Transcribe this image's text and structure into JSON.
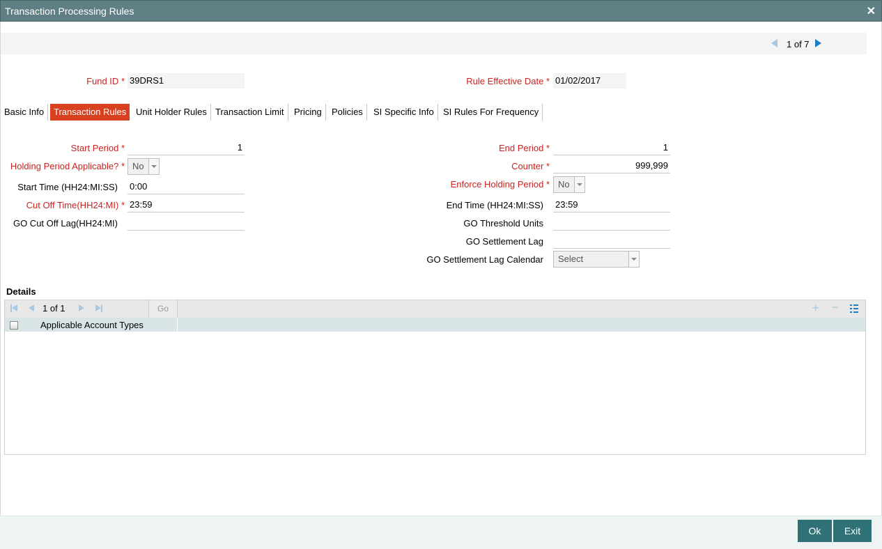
{
  "window": {
    "title": "Transaction Processing Rules",
    "close_glyph": "✕"
  },
  "pager": {
    "text": "1 of 7"
  },
  "header": {
    "fund_id_label": "Fund ID",
    "fund_id_value": "39DRS1",
    "rule_effective_date_label": "Rule Effective Date",
    "rule_effective_date_value": "01/02/2017",
    "required_mark": "*"
  },
  "tabs": [
    {
      "label": "Basic Info",
      "active": false
    },
    {
      "label": "Transaction Rules",
      "active": true
    },
    {
      "label": "Unit Holder Rules",
      "active": false
    },
    {
      "label": "Transaction Limit",
      "active": false
    },
    {
      "label": "Pricing",
      "active": false
    },
    {
      "label": "Policies",
      "active": false
    },
    {
      "label": "SI Specific Info",
      "active": false
    },
    {
      "label": "SI Rules For Frequency",
      "active": false
    }
  ],
  "form": {
    "start_period": {
      "label": "Start Period",
      "value": "1"
    },
    "holding_period_applicable": {
      "label": "Holding Period Applicable?",
      "value": "No"
    },
    "start_time": {
      "label": "Start Time (HH24:MI:SS)",
      "value": "0:00"
    },
    "cut_off_time": {
      "label": "Cut Off Time(HH24:MI)",
      "value": "23:59"
    },
    "go_cut_off_lag": {
      "label": "GO Cut Off Lag(HH24:MI)",
      "value": ""
    },
    "end_period": {
      "label": "End Period",
      "value": "1"
    },
    "counter": {
      "label": "Counter",
      "value": "999,999"
    },
    "enforce_holding_period": {
      "label": "Enforce Holding Period",
      "value": "No"
    },
    "end_time": {
      "label": "End Time (HH24:MI:SS)",
      "value": "23:59"
    },
    "go_threshold_units": {
      "label": "GO Threshold Units",
      "value": ""
    },
    "go_settlement_lag": {
      "label": "GO Settlement Lag",
      "value": ""
    },
    "go_settlement_lag_calendar": {
      "label": "GO Settlement Lag Calendar",
      "value": "Select"
    }
  },
  "details": {
    "title": "Details",
    "pager_text": "1 of 1",
    "go_label": "Go",
    "plus_glyph": "+",
    "minus_glyph": "−",
    "columns": [
      "Applicable Account Types"
    ],
    "rows": []
  },
  "footer": {
    "ok_label": "Ok",
    "exit_label": "Exit"
  },
  "colors": {
    "titlebar": "#5f7f85",
    "accent": "#d9401f",
    "required": "#cc2222",
    "button": "#2f7176",
    "link_blue": "#1a7dc8"
  }
}
